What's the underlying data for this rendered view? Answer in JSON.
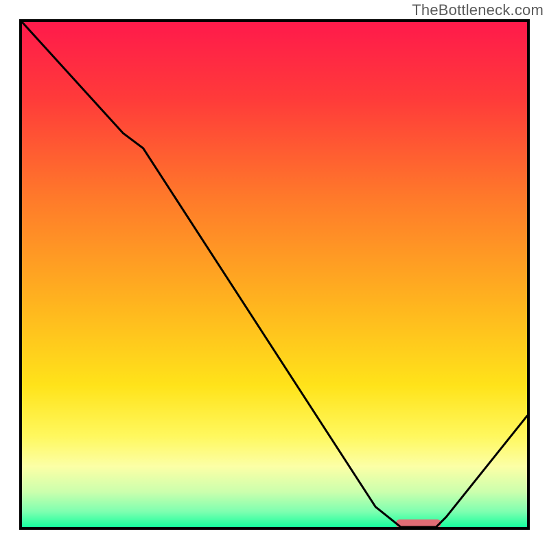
{
  "watermark": "TheBottleneck.com",
  "chart_data": {
    "type": "line",
    "title": "",
    "xlabel": "",
    "ylabel": "",
    "xlim": [
      0,
      100
    ],
    "ylim": [
      0,
      100
    ],
    "series": [
      {
        "name": "curve",
        "x": [
          0,
          20,
          24,
          70,
          75,
          82,
          84,
          100
        ],
        "y": [
          100,
          78,
          75,
          4,
          0,
          0,
          2,
          22
        ]
      }
    ],
    "marker_segment": {
      "x0": 74,
      "x1": 83,
      "y": 0.7
    },
    "gradient_stops": [
      {
        "offset": 0.0,
        "color": "#ff1a4b"
      },
      {
        "offset": 0.15,
        "color": "#ff3a3a"
      },
      {
        "offset": 0.35,
        "color": "#ff7a2a"
      },
      {
        "offset": 0.55,
        "color": "#ffb21f"
      },
      {
        "offset": 0.72,
        "color": "#ffe31a"
      },
      {
        "offset": 0.82,
        "color": "#fff85e"
      },
      {
        "offset": 0.88,
        "color": "#fcffa6"
      },
      {
        "offset": 0.93,
        "color": "#ccffad"
      },
      {
        "offset": 0.97,
        "color": "#7dffb0"
      },
      {
        "offset": 1.0,
        "color": "#16ff9e"
      }
    ],
    "marker_color": "#e06c75"
  }
}
